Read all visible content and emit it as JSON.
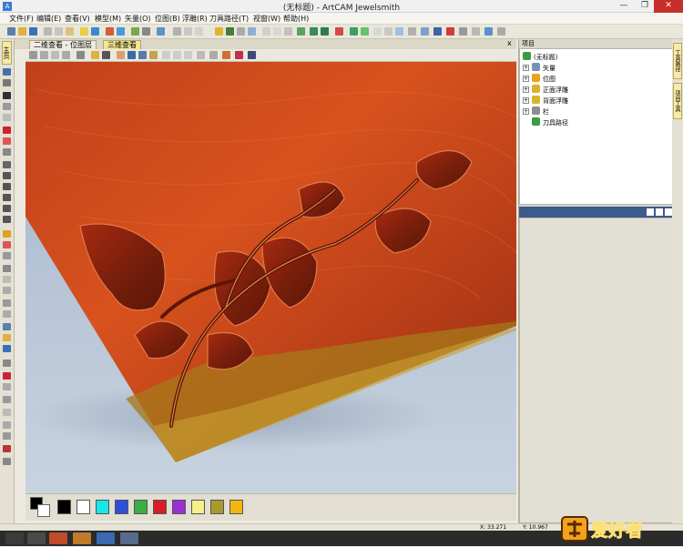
{
  "window": {
    "title": "(无标题) - ArtCAM Jewelsmith",
    "minimize_glyph": "—",
    "restore_glyph": "❐",
    "close_glyph": "✕"
  },
  "menu": [
    "文件(F)",
    "编辑(E)",
    "查看(V)",
    "模型(M)",
    "矢量(O)",
    "位图(B)",
    "浮雕(R)",
    "刀具路径(T)",
    "视窗(W)",
    "帮助(H)"
  ],
  "view_tabs": [
    "二维查看 - 位图层",
    "三维查看"
  ],
  "view_tab_close": "x",
  "left_side_tab": "主页",
  "palette": {
    "colors": [
      "#000000",
      "#ffffff",
      "#19e6e6",
      "#2f4fd9",
      "#39b043",
      "#d91c2a",
      "#9a2fd6",
      "#f6ef8a",
      "#a89a2c",
      "#f2b70f"
    ]
  },
  "project_panel": {
    "title": "项目",
    "items": [
      {
        "label": "(无标题)",
        "icon": "project-icon",
        "expand": "",
        "color": "#3b9c42"
      },
      {
        "label": "矢量",
        "icon": "vector-icon",
        "expand": "+",
        "color": "#7a8fb5"
      },
      {
        "label": "位图",
        "icon": "bitmap-icon",
        "expand": "+",
        "color": "#e8a21c"
      },
      {
        "label": "正面浮雕",
        "icon": "front-relief-icon",
        "expand": "+",
        "color": "#d9b42a"
      },
      {
        "label": "背面浮雕",
        "icon": "back-relief-icon",
        "expand": "+",
        "color": "#d9b42a"
      },
      {
        "label": "栏",
        "icon": "rail-icon",
        "expand": "+",
        "color": "#8d8d8d"
      },
      {
        "label": "刀具路径",
        "icon": "toolpath-icon",
        "expand": "",
        "color": "#3b9c42"
      }
    ]
  },
  "right_tabs": [
    "工具路径",
    "项目工具"
  ],
  "status": {
    "x": "X: 33.271",
    "y": "Y: 10.967"
  },
  "watermark": {
    "text": "木工爱好者"
  }
}
